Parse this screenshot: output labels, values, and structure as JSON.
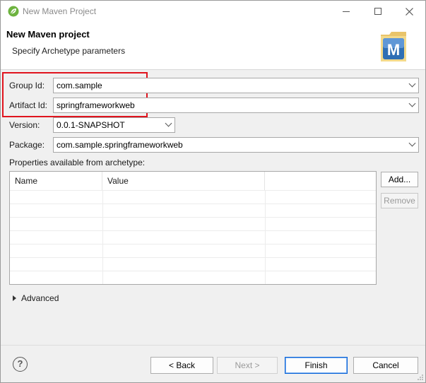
{
  "window": {
    "title": "New Maven Project"
  },
  "header": {
    "title": "New Maven project",
    "subtitle": "Specify Archetype parameters",
    "logo_letter": "M"
  },
  "form": {
    "group_id_label": "Group Id:",
    "group_id_value": "com.sample",
    "artifact_id_label": "Artifact Id:",
    "artifact_id_value": "springframeworkweb",
    "version_label": "Version:",
    "version_value": "0.0.1-SNAPSHOT",
    "package_label": "Package:",
    "package_value": "com.sample.springframeworkweb"
  },
  "properties": {
    "label": "Properties available from archetype:",
    "columns": [
      "Name",
      "Value",
      ""
    ],
    "rows": [],
    "add_button": "Add...",
    "remove_button": "Remove"
  },
  "advanced": {
    "label": "Advanced"
  },
  "footer": {
    "help_symbol": "?",
    "back_button": "< Back",
    "next_button": "Next >",
    "finish_button": "Finish",
    "cancel_button": "Cancel"
  },
  "colors": {
    "highlight": "#e0141e",
    "default_button_border": "#0a64d8",
    "maven_blue": "#2f6fb4"
  }
}
